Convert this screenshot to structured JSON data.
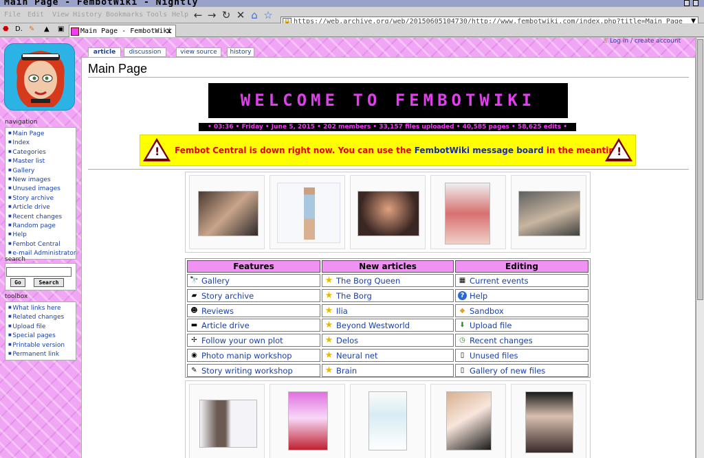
{
  "window": {
    "title": "Main Page - FembotWiki - Nightly"
  },
  "menu": [
    "File",
    "Edit",
    "View",
    "History",
    "Bookmarks",
    "Tools",
    "Help"
  ],
  "url": "https://web.archive.org/web/20150605104730/http://www.fembotwiki.com/index.php?title=Main_Page",
  "tab": {
    "title": "Main Page - FembotWiki",
    "close": "×"
  },
  "page_tabs": [
    "article",
    "discussion",
    "view source",
    "history"
  ],
  "login": "Log in / create account",
  "sidebar": {
    "nav_heading": "navigation",
    "nav": [
      "Main Page",
      "Index",
      "Categories",
      "Master list",
      "Gallery",
      "New images",
      "Unused images",
      "Story archive",
      "Article drive",
      "Recent changes",
      "Random page",
      "Help",
      "Fembot Central",
      "e-mail Administrator"
    ],
    "search_heading": "search",
    "go": "Go",
    "search": "Search",
    "toolbox_heading": "toolbox",
    "toolbox": [
      "What links here",
      "Related changes",
      "Upload file",
      "Special pages",
      "Printable version",
      "Permanent link"
    ]
  },
  "main": {
    "title": "Main Page",
    "banner": "WELCOME TO FEMBOTWIKI",
    "stats": "• 03:36 • Friday • June 5, 2015 • 202 members • 33,157 files uploaded • 40,585 pages • 58,625 edits •",
    "warning_red1": "Fembot Central is down right now. You can use the ",
    "warning_link1": "FembotWiki",
    "warning_link2": "message board",
    "warning_red2": " in the meantime."
  },
  "table": {
    "headers": [
      "Features",
      "New articles",
      "Editing"
    ],
    "features": [
      {
        "label": "Gallery",
        "icon": "binoculars-icon"
      },
      {
        "label": "Story archive",
        "icon": "book-icon"
      },
      {
        "label": "Reviews",
        "icon": "people-icon"
      },
      {
        "label": "Article drive",
        "icon": "car-icon"
      },
      {
        "label": "Follow your own plot",
        "icon": "arrows-icon"
      },
      {
        "label": "Photo manip workshop",
        "icon": "camera-icon"
      },
      {
        "label": "Story writing workshop",
        "icon": "pen-icon"
      }
    ],
    "articles": [
      "The Borg Queen",
      "The Borg",
      "Ilia",
      "Beyond Westworld",
      "Delos",
      "Neural net",
      "Brain"
    ],
    "editing": [
      {
        "label": "Current events",
        "icon": "calendar-icon"
      },
      {
        "label": "Help",
        "icon": "help-icon"
      },
      {
        "label": "Sandbox",
        "icon": "sandbox-icon"
      },
      {
        "label": "Upload file",
        "icon": "upload-icon"
      },
      {
        "label": "Recent changes",
        "icon": "recent-icon"
      },
      {
        "label": "Unused files",
        "icon": "file-icon"
      },
      {
        "label": "Gallery of new files",
        "icon": "new-file-icon"
      }
    ]
  },
  "colors": {
    "page_bg": "#f0a6f4",
    "banner_text": "#e23ef0",
    "warning_bg": "#ffff00",
    "header_bg": "#f092f4",
    "link": "#1a41a8"
  }
}
